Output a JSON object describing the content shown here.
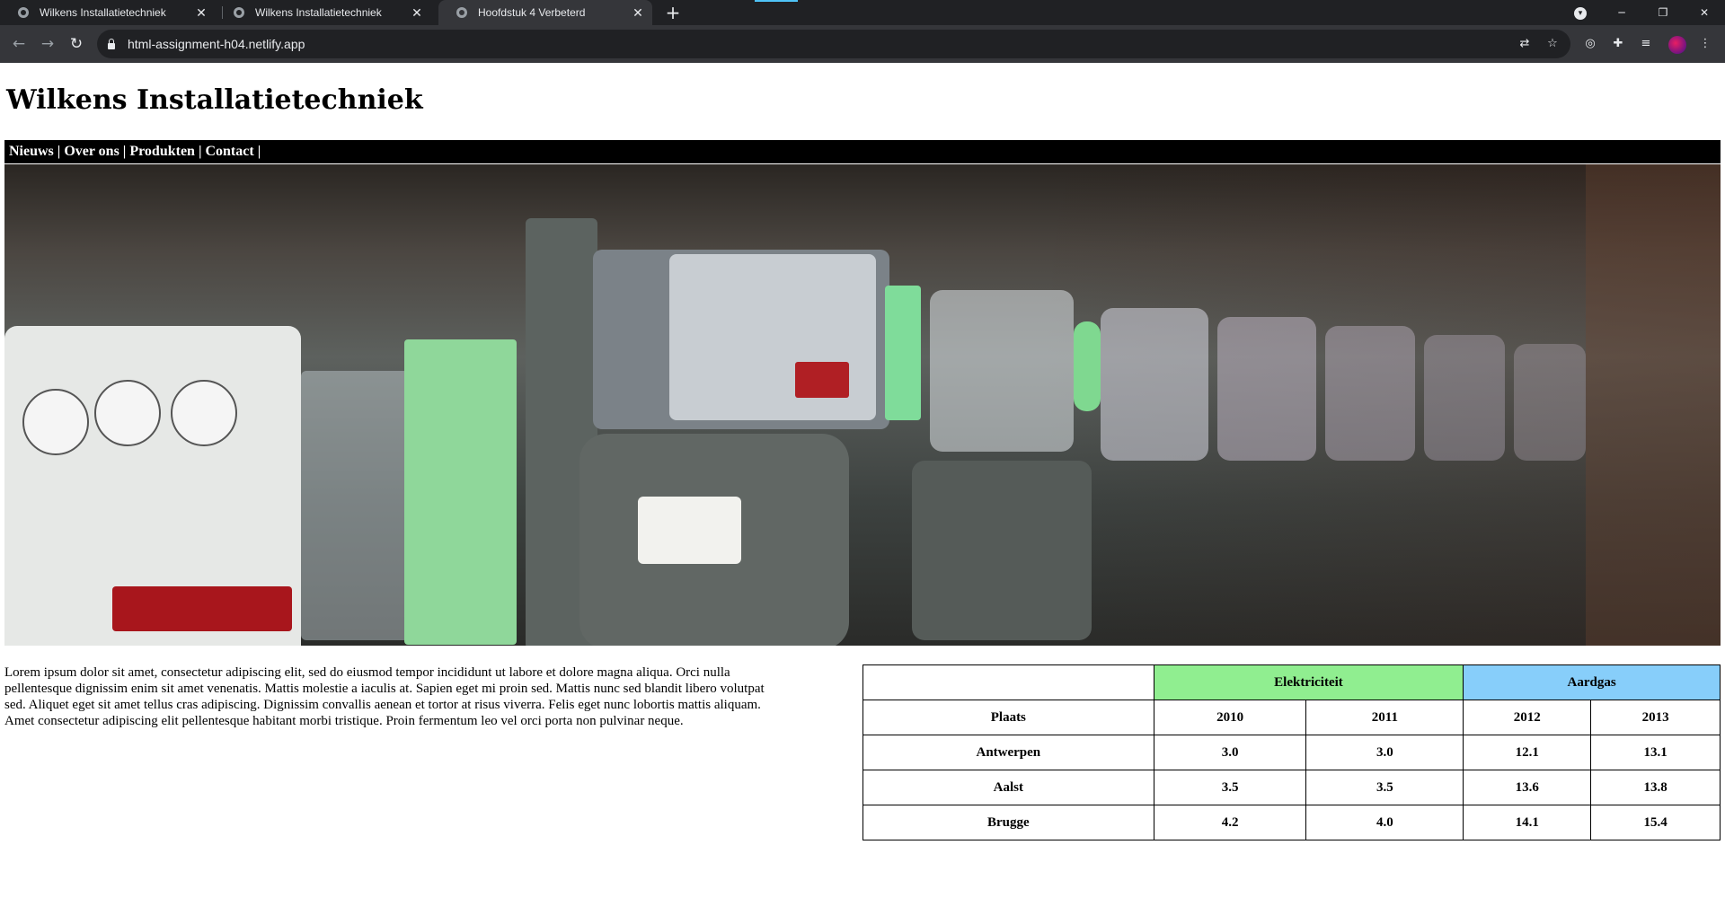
{
  "browser": {
    "tabs": [
      {
        "title": "Wilkens Installatietechniek",
        "active": false
      },
      {
        "title": "Wilkens Installatietechniek",
        "active": false
      },
      {
        "title": "Hoofdstuk 4 Verbeterd",
        "active": true
      }
    ],
    "url": "html-assignment-h04.netlify.app",
    "icons": {
      "back": "back-arrow-icon",
      "forward": "forward-arrow-icon",
      "reload": "reload-icon",
      "translate": "translate-icon",
      "bookmark": "star-icon",
      "extensions": "puzzle-icon",
      "reading_list": "reading-list-icon",
      "menu": "kebab-menu-icon"
    }
  },
  "site": {
    "title": "Wilkens Installatietechniek",
    "nav": [
      "Nieuws",
      "Over ons",
      "Produkten",
      "Contact"
    ],
    "nav_separator": " | ",
    "body_text": "Lorem ipsum dolor sit amet, consectetur adipiscing elit, sed do eiusmod tempor incididunt ut labore et dolore magna aliqua. Orci nulla pellentesque dignissim enim sit amet venenatis. Mattis molestie a iaculis at. Sapien eget mi proin sed. Mattis nunc sed blandit libero volutpat sed. Aliquet eget sit amet tellus cras adipiscing. Dignissim convallis aenean et tortor at risus viverra. Felis eget nunc lobortis mattis aliquam. Amet consectetur adipiscing elit pellentesque habitant morbi tristique. Proin fermentum leo vel orci porta non pulvinar neque."
  },
  "table": {
    "group_headers": [
      {
        "label": "Elektriciteit",
        "color": "#90ee90"
      },
      {
        "label": "Aardgas",
        "color": "#87cefa"
      }
    ],
    "columns": [
      "Plaats",
      "2010",
      "2011",
      "2012",
      "2013"
    ],
    "rows": [
      [
        "Antwerpen",
        "3.0",
        "3.0",
        "12.1",
        "13.1"
      ],
      [
        "Aalst",
        "3.5",
        "3.5",
        "13.6",
        "13.8"
      ],
      [
        "Brugge",
        "4.2",
        "4.0",
        "14.1",
        "15.4"
      ]
    ]
  },
  "colors": {
    "chrome_dark": "#202124",
    "chrome_toolbar": "#35363a",
    "navbar": "#000000"
  }
}
